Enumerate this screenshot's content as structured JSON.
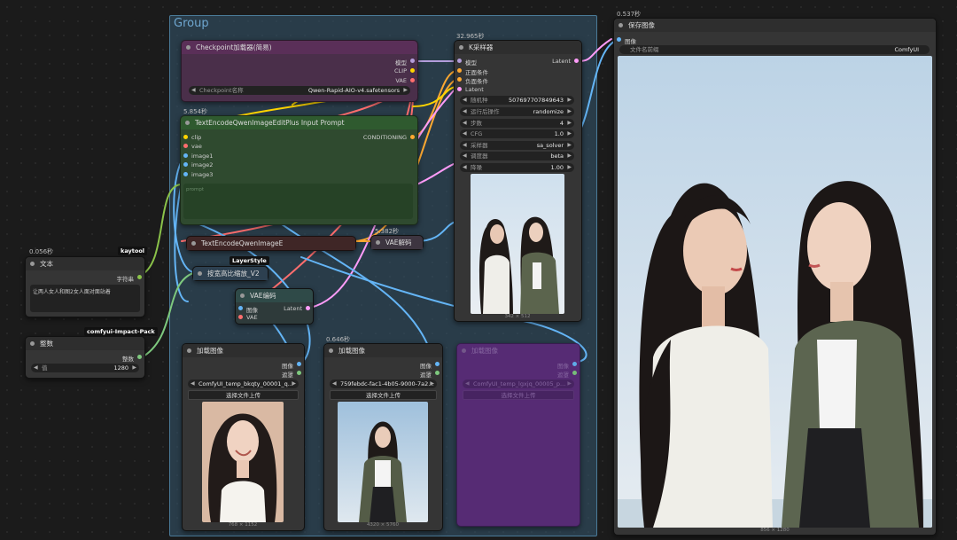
{
  "group": {
    "title": "Group"
  },
  "nodes": {
    "checkpoint": {
      "title": "Checkpoint加载器(简易)",
      "outputs": [
        "模型",
        "CLIP",
        "VAE"
      ],
      "widget": {
        "label": "Checkpoint名称",
        "value": "Qwen-Rapid-AIO-v4.safetensors"
      }
    },
    "textencode_plus": {
      "time": "5.854秒",
      "title": "TextEncodeQwenImageEditPlus Input Prompt",
      "inputs": [
        "clip",
        "vae",
        "image1",
        "image2",
        "image3"
      ],
      "output": "CONDITIONING",
      "textarea_label": "prompt"
    },
    "textencode": {
      "title": "TextEncodeQwenImageE"
    },
    "vae_decode": {
      "time": "5.382秒",
      "title": "VAE解码"
    },
    "ksampler": {
      "time": "32.965秒",
      "title": "K采样器",
      "inputs": [
        "模型",
        "正面条件",
        "负面条件",
        "Latent"
      ],
      "output": "Latent",
      "widgets": [
        {
          "label": "随机种",
          "value": "507697707849643"
        },
        {
          "label": "运行后操作",
          "value": "randomize"
        },
        {
          "label": "步数",
          "value": "4"
        },
        {
          "label": "CFG",
          "value": "1.0"
        },
        {
          "label": "采样器",
          "value": "sa_solver"
        },
        {
          "label": "调度器",
          "value": "beta"
        },
        {
          "label": "降噪",
          "value": "1.00"
        }
      ],
      "preview_dims": "342 × 512"
    },
    "save_image": {
      "time": "0.537秒",
      "title": "保存图像",
      "input": "图像",
      "widget": {
        "label": "文件名前缀",
        "value": "ComfyUI"
      },
      "preview_dims": "856 × 1280"
    },
    "text": {
      "time": "0.056秒",
      "badge": "kaytool",
      "title": "文本",
      "output": "字符串",
      "content": "让两人女人和图2女人面对面站着"
    },
    "integer": {
      "badge": "comfyui-Impact-Pack",
      "title": "整数",
      "output": "整数",
      "widget": {
        "label": "值",
        "value": "1280"
      }
    },
    "scale": {
      "badge": "LayerStyle",
      "title": "按宽高比缩放_V2"
    },
    "vae_encode": {
      "title": "VAE编码",
      "inputs": [
        "图像",
        "VAE"
      ],
      "output": "Latent"
    },
    "load1": {
      "title": "加载图像",
      "outputs": [
        "图像",
        "遮罩"
      ],
      "widget": "ComfyUI_temp_bkqty_00001_q...",
      "button": "选择文件上传",
      "dims": "768 × 1152"
    },
    "load2": {
      "time": "0.646秒",
      "title": "加载图像",
      "outputs": [
        "图像",
        "遮罩"
      ],
      "widget": "759febdc-fac1-4b05-9000-7a2...",
      "button": "选择文件上传",
      "dims": "4320 × 5760"
    },
    "load3": {
      "title": "加载图像",
      "outputs": [
        "图像",
        "遮罩"
      ],
      "widget": "ComfyUI_temp_lgxjq_00005_p...",
      "button": "选择文件上传"
    }
  },
  "colors": {
    "model": "#b39ddb",
    "clip": "#ffd500",
    "vae": "#ff6e6e",
    "image": "#64b5f6",
    "latent": "#ff9cf9",
    "conditioning": "#ffa931",
    "string": "#8bc34a",
    "int": "#7ec97e"
  },
  "icons": {
    "widget_left": "triangle-left",
    "widget_right": "triangle-right",
    "node_dot": "circle"
  }
}
